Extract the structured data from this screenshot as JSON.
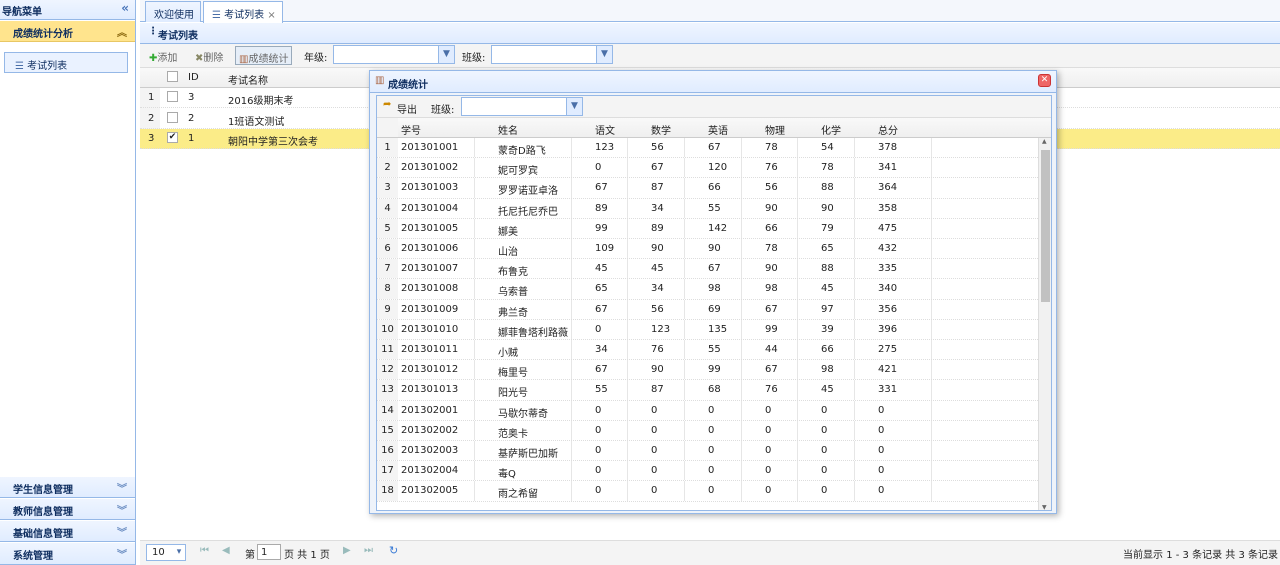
{
  "sidebar": {
    "title": "导航菜单",
    "collapse_icon": "double-chevron-left-icon",
    "active_section": "成绩统计分析",
    "active_item": "考试列表",
    "sections": [
      "学生信息管理",
      "教师信息管理",
      "基础信息管理",
      "系统管理"
    ]
  },
  "tabs": [
    "欢迎使用",
    "考试列表"
  ],
  "panel": {
    "title": "考试列表"
  },
  "toolbar": {
    "add": "添加",
    "delete": "删除",
    "stats": "成绩统计",
    "grade_label": "年级:",
    "class_label": "班级:"
  },
  "grid": {
    "headers": [
      "ID",
      "考试名称"
    ],
    "rows": [
      {
        "num": "1",
        "id": "3",
        "name": "2016级期末考",
        "checked": false
      },
      {
        "num": "2",
        "id": "2",
        "name": "1班语文测试",
        "checked": false
      },
      {
        "num": "3",
        "id": "1",
        "name": "朝阳中学第三次会考",
        "checked": true
      }
    ]
  },
  "pager": {
    "page_size": "10",
    "page_prefix": "第",
    "page_value": "1",
    "page_suffix": "页 共 1 页",
    "summary": "当前显示 1 - 3 条记录 共 3 条记录"
  },
  "dialog": {
    "title": "成绩统计",
    "export": "导出",
    "class_label": "班级:",
    "headers": [
      "学号",
      "姓名",
      "语文",
      "数学",
      "英语",
      "物理",
      "化学",
      "总分"
    ],
    "rows": [
      [
        "1",
        "201301001",
        "蒙奇D路飞",
        "123",
        "56",
        "67",
        "78",
        "54",
        "378"
      ],
      [
        "2",
        "201301002",
        "妮可罗宾",
        "0",
        "67",
        "120",
        "76",
        "78",
        "341"
      ],
      [
        "3",
        "201301003",
        "罗罗诺亚卓洛",
        "67",
        "87",
        "66",
        "56",
        "88",
        "364"
      ],
      [
        "4",
        "201301004",
        "托尼托尼乔巴",
        "89",
        "34",
        "55",
        "90",
        "90",
        "358"
      ],
      [
        "5",
        "201301005",
        "娜美",
        "99",
        "89",
        "142",
        "66",
        "79",
        "475"
      ],
      [
        "6",
        "201301006",
        "山治",
        "109",
        "90",
        "90",
        "78",
        "65",
        "432"
      ],
      [
        "7",
        "201301007",
        "布鲁克",
        "45",
        "45",
        "67",
        "90",
        "88",
        "335"
      ],
      [
        "8",
        "201301008",
        "乌索普",
        "65",
        "34",
        "98",
        "98",
        "45",
        "340"
      ],
      [
        "9",
        "201301009",
        "弗兰奇",
        "67",
        "56",
        "69",
        "67",
        "97",
        "356"
      ],
      [
        "10",
        "201301010",
        "娜菲鲁塔利路薇",
        "0",
        "123",
        "135",
        "99",
        "39",
        "396"
      ],
      [
        "11",
        "201301011",
        "小贼",
        "34",
        "76",
        "55",
        "44",
        "66",
        "275"
      ],
      [
        "12",
        "201301012",
        "梅里号",
        "67",
        "90",
        "99",
        "67",
        "98",
        "421"
      ],
      [
        "13",
        "201301013",
        "阳光号",
        "55",
        "87",
        "68",
        "76",
        "45",
        "331"
      ],
      [
        "14",
        "201302001",
        "马歇尔蒂奇",
        "0",
        "0",
        "0",
        "0",
        "0",
        "0"
      ],
      [
        "15",
        "201302002",
        "范奥卡",
        "0",
        "0",
        "0",
        "0",
        "0",
        "0"
      ],
      [
        "16",
        "201302003",
        "基萨斯巴加斯",
        "0",
        "0",
        "0",
        "0",
        "0",
        "0"
      ],
      [
        "17",
        "201302004",
        "毒Q",
        "0",
        "0",
        "0",
        "0",
        "0",
        "0"
      ],
      [
        "18",
        "201302005",
        "雨之希留",
        "0",
        "0",
        "0",
        "0",
        "0",
        "0"
      ]
    ]
  }
}
